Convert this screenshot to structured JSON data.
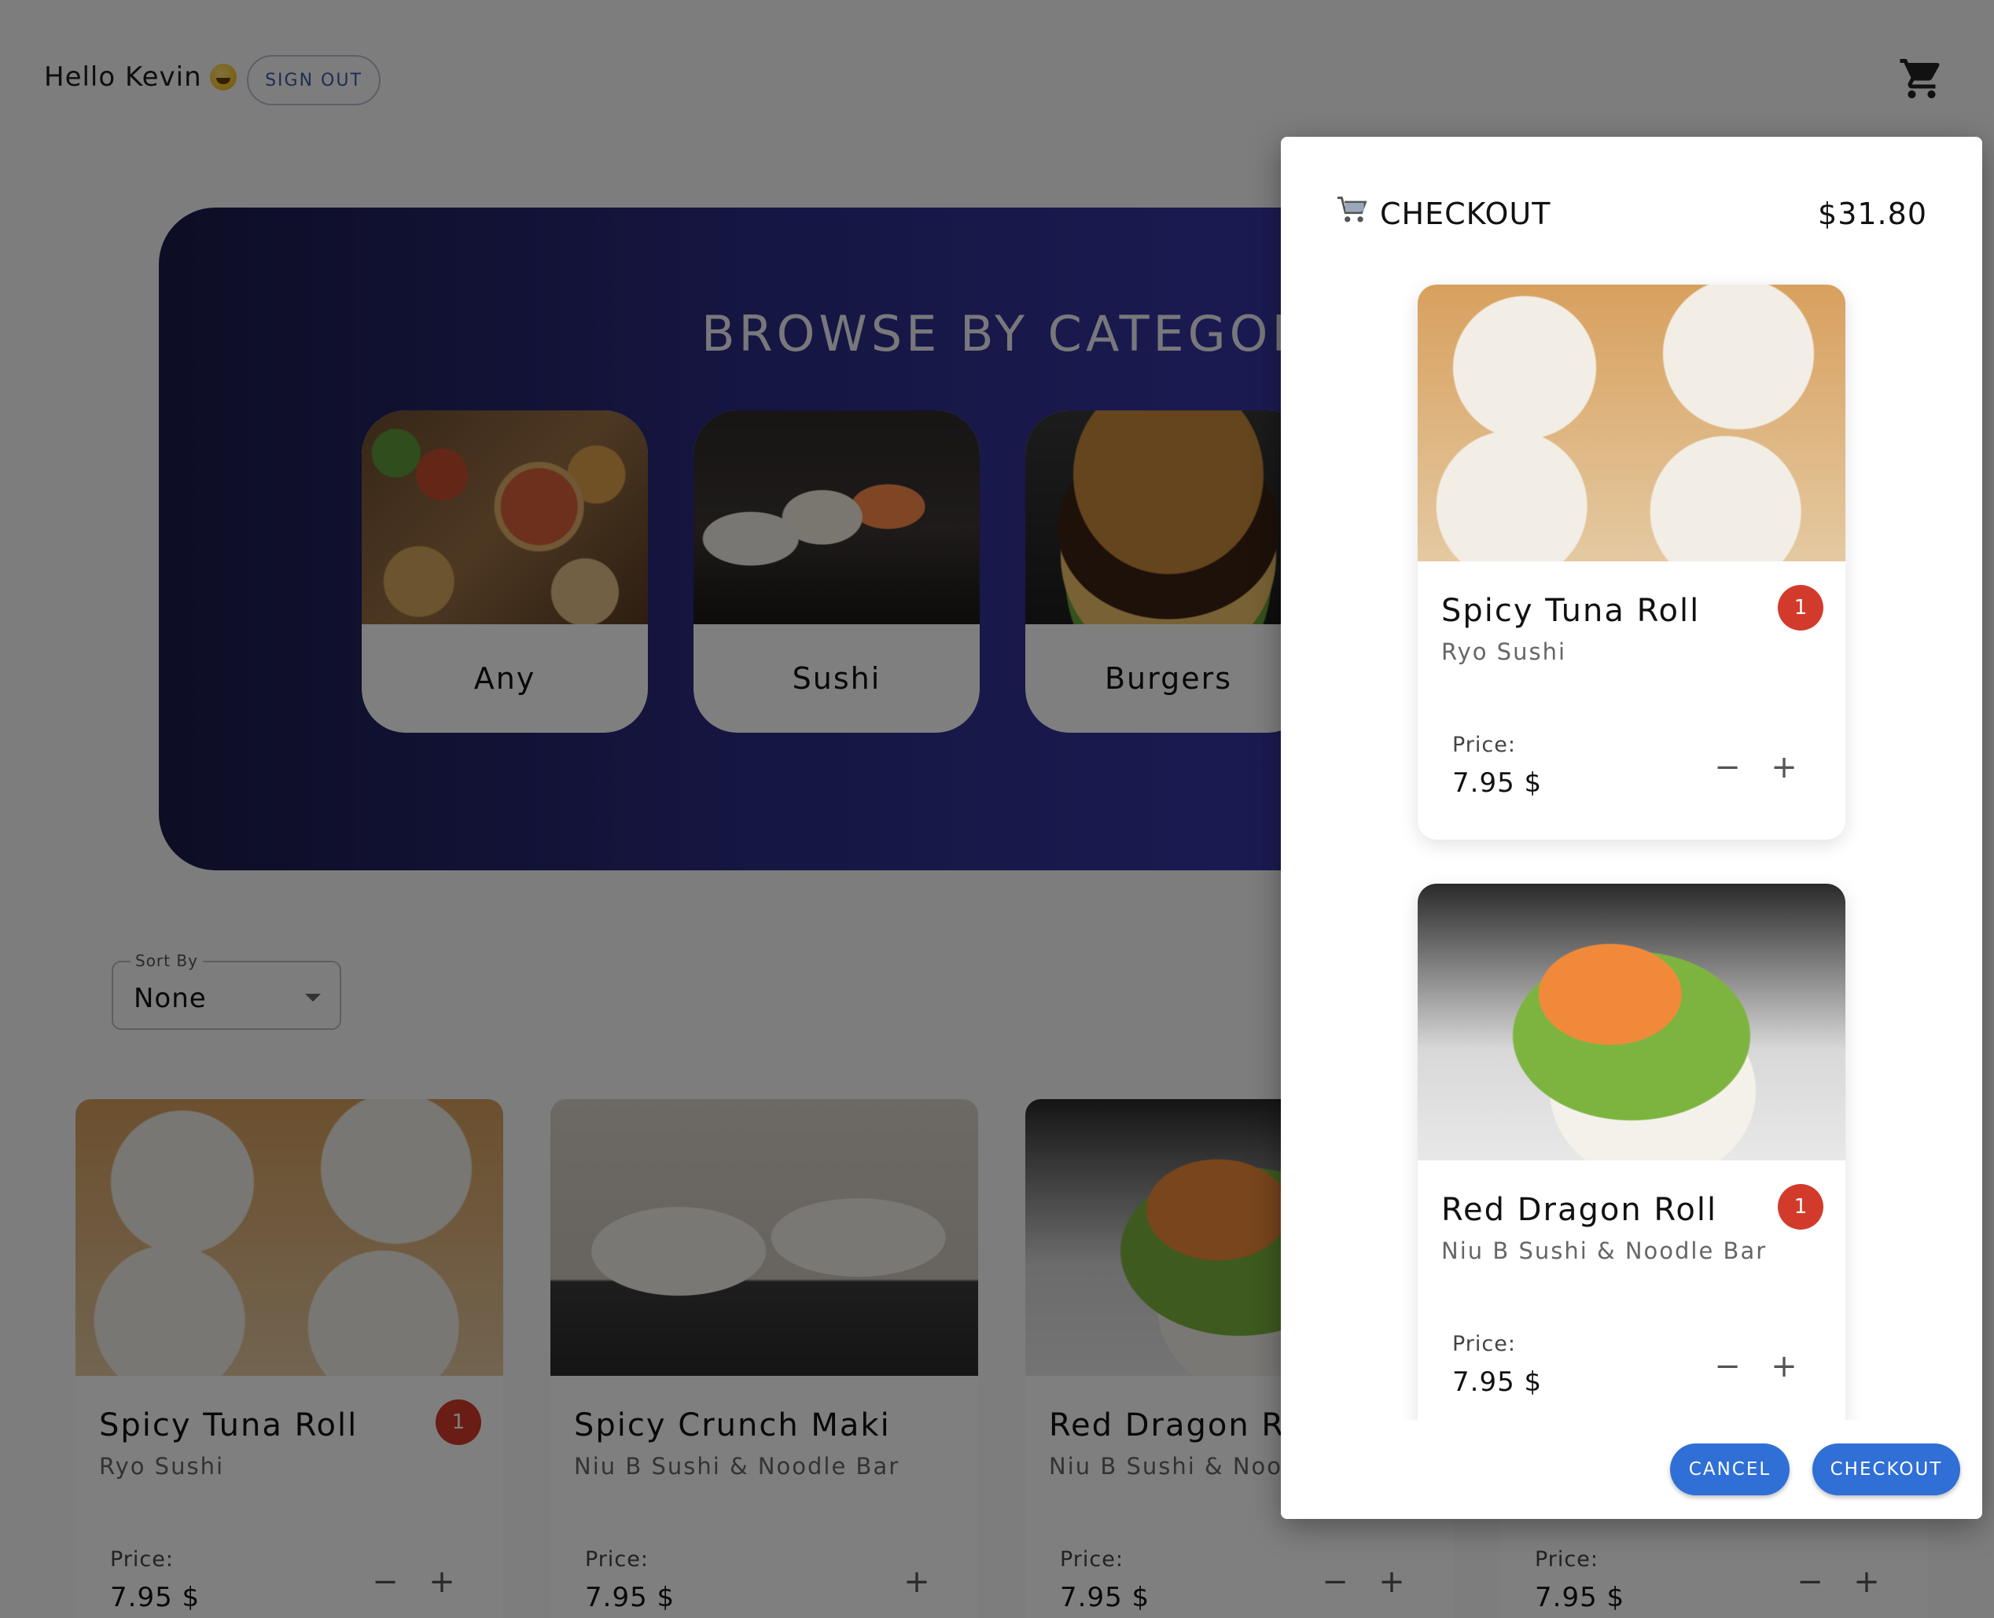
{
  "header": {
    "greeting": "Hello Kevin",
    "greeting_emoji": "grinning-face-emoji",
    "signout_label": "SIGN OUT",
    "cart_icon": "shopping-cart-icon"
  },
  "hero": {
    "title": "BROWSE BY CATEGORY",
    "categories": [
      {
        "label": "Any"
      },
      {
        "label": "Sushi"
      },
      {
        "label": "Burgers"
      }
    ]
  },
  "sort": {
    "legend": "Sort By",
    "value": "None"
  },
  "products": [
    {
      "name": "Spicy Tuna Roll",
      "restaurant": "Ryo Sushi",
      "price_label": "Price:",
      "price": "7.95 $",
      "quantity": "1"
    },
    {
      "name": "Spicy Crunch Maki",
      "restaurant": "Niu B Sushi & Noodle Bar",
      "price_label": "Price:",
      "price": "7.95 $"
    },
    {
      "name": "Red Dragon Roll",
      "restaurant": "Niu B Sushi & Noodle Bar",
      "price_label": "Price:",
      "price": "7.95 $"
    },
    {
      "price_label": "Price:",
      "price": "7.95 $"
    }
  ],
  "checkout": {
    "title": "CHECKOUT",
    "title_icon": "shopping-cart-icon",
    "total": "$31.80",
    "items": [
      {
        "name": "Spicy Tuna Roll",
        "restaurant": "Ryo Sushi",
        "price_label": "Price:",
        "price": "7.95 $",
        "quantity": "1"
      },
      {
        "name": "Red Dragon Roll",
        "restaurant": "Niu B Sushi & Noodle Bar",
        "price_label": "Price:",
        "price": "7.95 $",
        "quantity": "1"
      }
    ],
    "cancel_label": "CANCEL",
    "checkout_label": "CHECKOUT",
    "button_color": "#2f6fd6"
  },
  "colors": {
    "badge": "#d23b2b",
    "hero_gradient_start": "#1a1b4a",
    "hero_gradient_end": "#3a3ab3"
  }
}
